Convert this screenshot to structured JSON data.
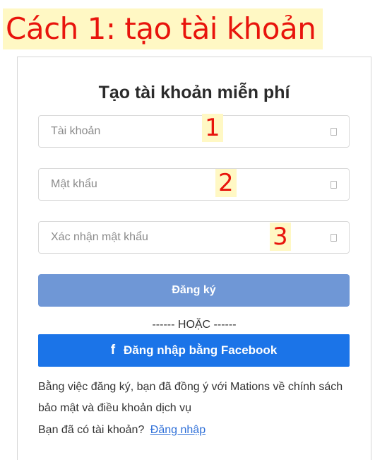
{
  "caption": "Cách 1: tạo tài khoản",
  "form": {
    "title": "Tạo tài khoản miễn phí",
    "fields": [
      {
        "placeholder": "Tài khoản",
        "step": "1"
      },
      {
        "placeholder": "Mật khẩu",
        "step": "2"
      },
      {
        "placeholder": "Xác nhận mật khẩu",
        "step": "3"
      }
    ],
    "register_label": "Đăng ký",
    "divider": "------ HOẶC ------",
    "facebook_icon": "f",
    "facebook_label": "Đăng nhập bằng Facebook",
    "terms": "Bằng việc đăng ký, bạn đã đồng ý với Mations về chính sách bảo mật và điều khoản dịch vụ",
    "have_account": "Bạn đã có tài khoản?",
    "login_link": "Đăng nhập"
  },
  "colors": {
    "annotation_red": "#e8140c",
    "annotation_highlight": "#fff8c4",
    "register_button": "#6f97d6",
    "facebook_button": "#1b74e8",
    "link": "#2e6fd8"
  },
  "icons": {
    "field_icon": "field-icon",
    "facebook": "facebook-icon"
  }
}
